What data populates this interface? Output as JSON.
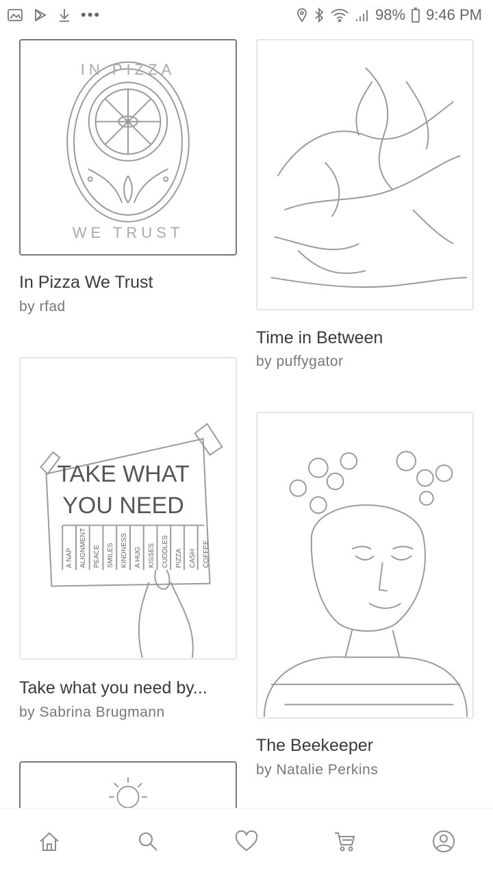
{
  "status_bar": {
    "battery": "98%",
    "time": "9:46 PM"
  },
  "feed": [
    {
      "title": "In Pizza We Trust",
      "author": "by rfad",
      "art_text": [
        "IN PIZZA",
        "WE TRUST"
      ]
    },
    {
      "title": "Time in Between",
      "author": "by puffygator"
    },
    {
      "title": "Take what you need by...",
      "author": "by Sabrina Brugmann",
      "art_text": [
        "TAKE WHAT",
        "YOU NEED"
      ],
      "tabs": [
        "A NAP",
        "ALIGNMENT",
        "PEACE",
        "SMILES",
        "KINDNESS",
        "A HUG",
        "KISSES",
        "CUDDLES",
        "PIZZA",
        "CASH",
        "COFFEE"
      ]
    },
    {
      "title": "The Beekeeper",
      "author": "by Natalie Perkins"
    }
  ],
  "nav": {
    "items": [
      "home-icon",
      "search-icon",
      "heart-icon",
      "cart-icon",
      "profile-icon"
    ]
  },
  "colors": {
    "line": "#9a9a9a",
    "text": "#3a3a3a",
    "subtext": "#777777"
  }
}
